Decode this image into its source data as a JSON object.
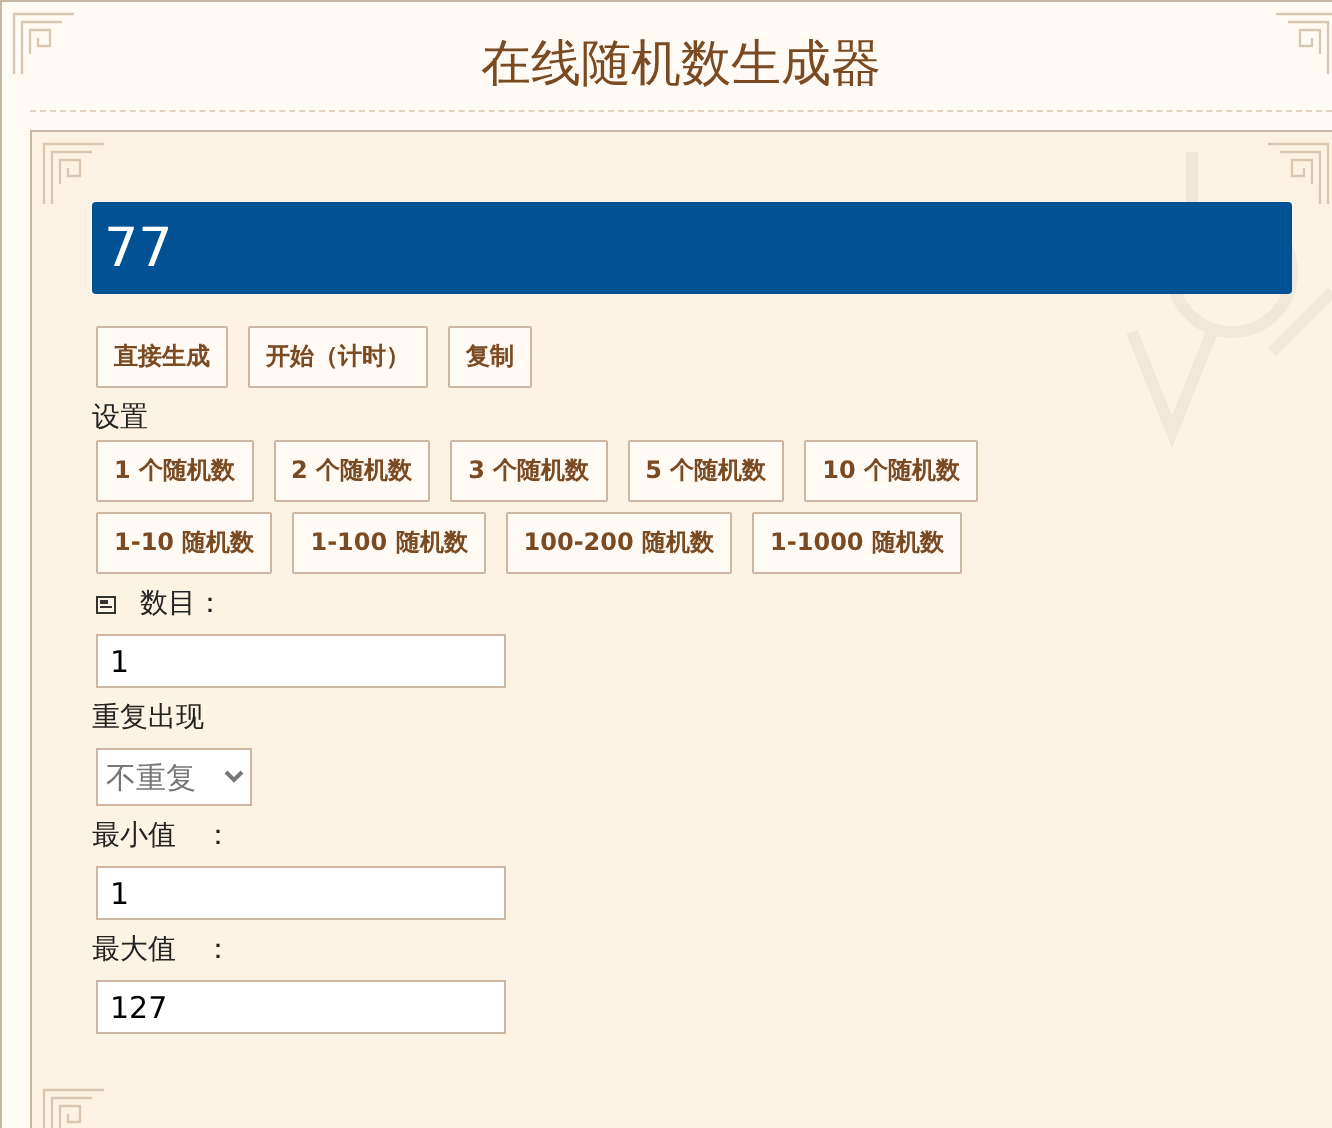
{
  "title": "在线随机数生成器",
  "result": "77",
  "actions": [
    "直接生成",
    "开始（计时）",
    "复制"
  ],
  "settings_label": "设置",
  "presets_row_1": [
    "1 个随机数",
    "2 个随机数",
    "3 个随机数",
    "5 个随机数",
    "10 个随机数"
  ],
  "presets_row_2": [
    "1-10 随机数",
    "1-100 随机数",
    "100-200 随机数",
    "1-1000 随机数"
  ],
  "fields": [
    {
      "kind": "input",
      "label": "数目：",
      "icon": true,
      "value": "1"
    },
    {
      "kind": "select",
      "label": "重复出现",
      "value": "不重复"
    },
    {
      "kind": "input",
      "label": "最小值　：",
      "value": "1"
    },
    {
      "kind": "input",
      "label": "最大值　：",
      "value": "127"
    }
  ]
}
